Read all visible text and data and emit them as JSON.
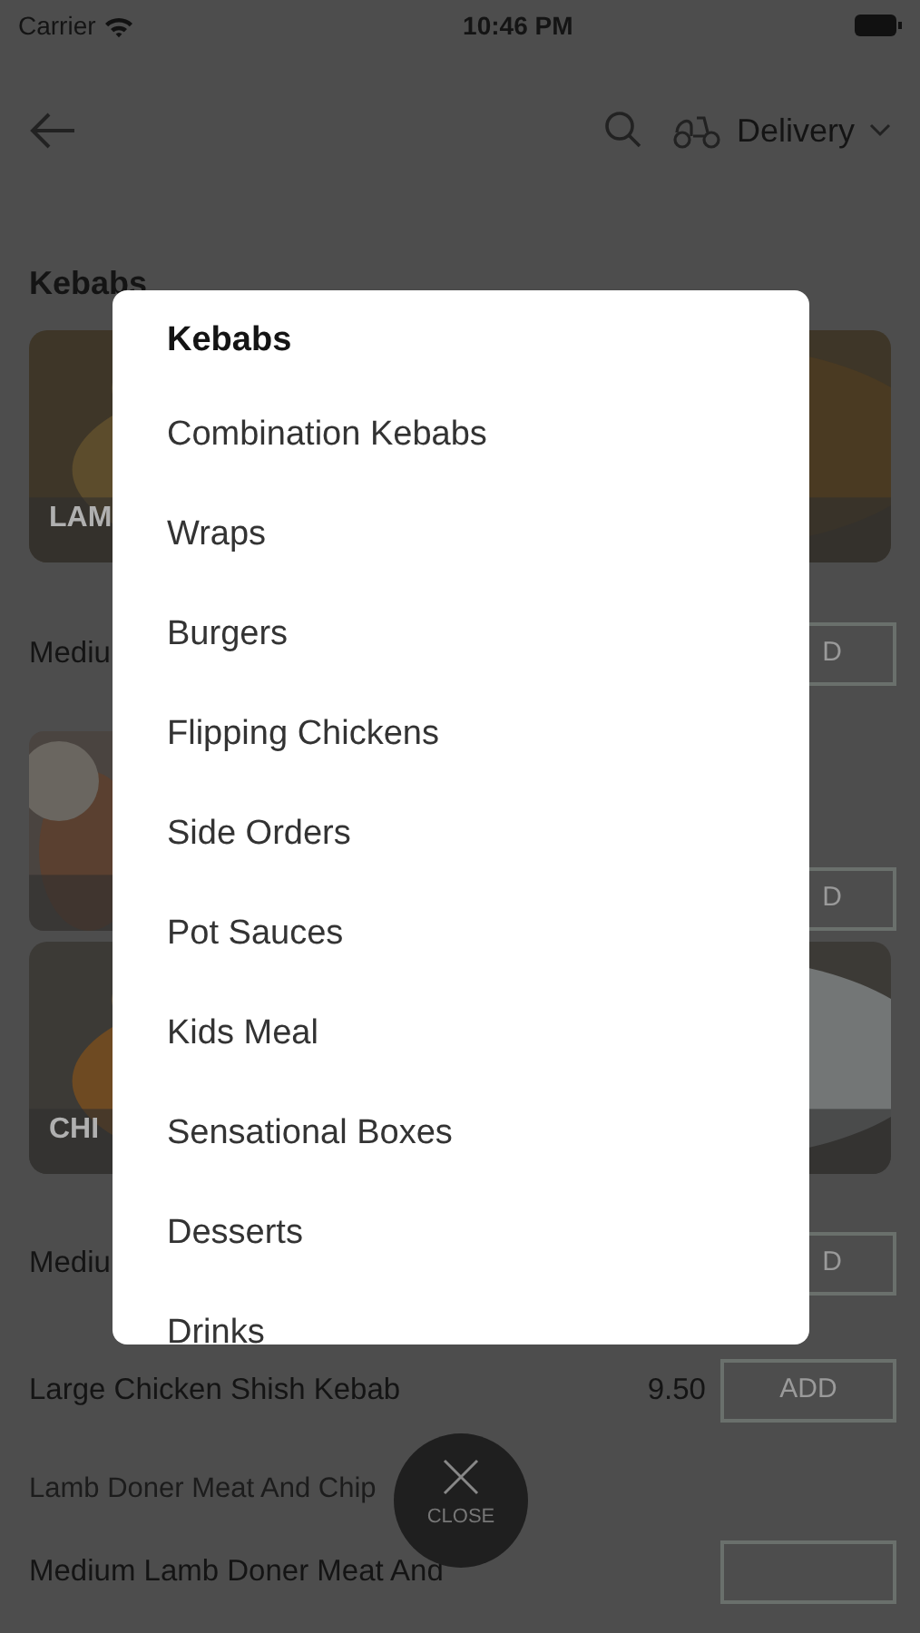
{
  "status_bar": {
    "carrier": "Carrier",
    "time": "10:46 PM"
  },
  "header": {
    "order_type": "Delivery"
  },
  "section_title": "Kebabs",
  "menu": [
    {
      "kind": "banner",
      "label": "LAM"
    },
    {
      "kind": "item",
      "name": "Mediu",
      "add": "D"
    },
    {
      "kind": "thumb_item",
      "add": "D"
    },
    {
      "kind": "banner",
      "label": "CHI"
    },
    {
      "kind": "item",
      "name": "Mediu",
      "add": "D"
    },
    {
      "kind": "item",
      "name": "Large Chicken Shish Kebab",
      "price": "9.50",
      "add": "ADD"
    },
    {
      "kind": "description",
      "text": "Lamb Doner Meat And Chip"
    },
    {
      "kind": "item",
      "name": "Medium Lamb Doner Meat And"
    }
  ],
  "category_menu": {
    "title": "Kebabs",
    "items": [
      "Combination Kebabs",
      "Wraps",
      "Burgers",
      "Flipping Chickens",
      "Side Orders",
      "Pot Sauces",
      "Kids Meal",
      "Sensational Boxes",
      "Desserts",
      "Drinks"
    ]
  },
  "close_button": {
    "label": "CLOSE"
  }
}
